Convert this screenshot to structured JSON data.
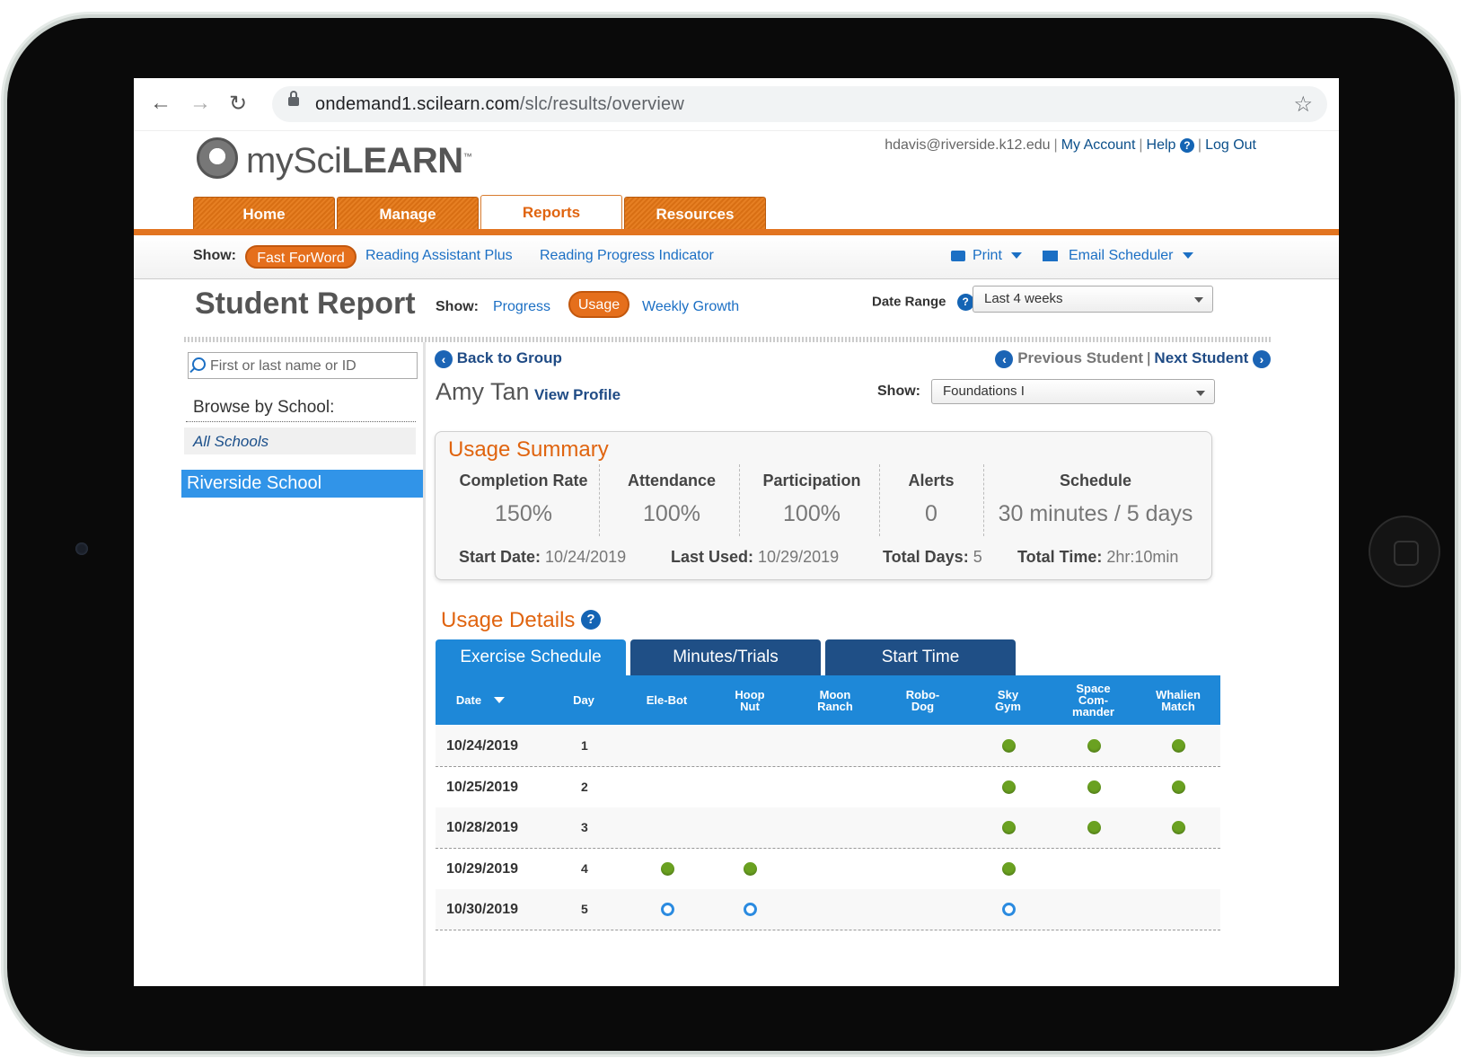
{
  "browser": {
    "url_host": "ondemand1.scilearn.com",
    "url_path": "/slc/results/overview"
  },
  "header": {
    "logo_prefix": "my",
    "logo_mid": "Sci",
    "logo_bold": "LEARN",
    "logo_tm": "™",
    "user_email": "hdavis@riverside.k12.edu",
    "my_account": "My Account",
    "help": "Help",
    "log_out": "Log Out"
  },
  "main_tabs": [
    {
      "label": "Home"
    },
    {
      "label": "Manage"
    },
    {
      "label": "Reports",
      "active": true
    },
    {
      "label": "Resources"
    }
  ],
  "subnav": {
    "show_label": "Show:",
    "product_active": "Fast ForWord",
    "product_2": "Reading Assistant Plus",
    "product_3": "Reading Progress Indicator",
    "print": "Print",
    "email_scheduler": "Email Scheduler"
  },
  "report": {
    "title": "Student Report",
    "show_label": "Show:",
    "view_progress": "Progress",
    "view_usage": "Usage",
    "view_weekly": "Weekly Growth",
    "date_range_label": "Date Range",
    "date_range_value": "Last 4 weeks"
  },
  "sidebar": {
    "search_placeholder": "First or last name or ID",
    "browse_label": "Browse by School:",
    "all_schools": "All Schools",
    "selected_school": "Riverside School"
  },
  "student": {
    "back": "Back to Group",
    "previous": "Previous Student",
    "next": "Next Student",
    "name": "Amy Tan",
    "view_profile": "View Profile",
    "show_label": "Show:",
    "product_value": "Foundations I"
  },
  "summary": {
    "title": "Usage Summary",
    "completion_rate_label": "Completion Rate",
    "completion_rate": "150%",
    "attendance_label": "Attendance",
    "attendance": "100%",
    "participation_label": "Participation",
    "participation": "100%",
    "alerts_label": "Alerts",
    "alerts": "0",
    "schedule_label": "Schedule",
    "schedule": "30 minutes / 5 days",
    "start_date_label": "Start Date:",
    "start_date": "10/24/2019",
    "last_used_label": "Last Used:",
    "last_used": "10/29/2019",
    "total_days_label": "Total Days:",
    "total_days": "5",
    "total_time_label": "Total Time:",
    "total_time": "2hr:10min"
  },
  "details": {
    "title": "Usage Details",
    "tabs": [
      "Exercise Schedule",
      "Minutes/Trials",
      "Start Time"
    ],
    "columns": [
      "Date",
      "Day",
      "Ele-Bot",
      "Hoop Nut",
      "Moon Ranch",
      "Robo-Dog",
      "Sky Gym",
      "Space Com-mander",
      "Whalien Match"
    ],
    "column_lines": [
      [
        "Date"
      ],
      [
        "Day"
      ],
      [
        "Ele-Bot"
      ],
      [
        "Hoop",
        "Nut"
      ],
      [
        "Moon",
        "Ranch"
      ],
      [
        "Robo-",
        "Dog"
      ],
      [
        "Sky",
        "Gym"
      ],
      [
        "Space",
        "Com-",
        "mander"
      ],
      [
        "Whalien",
        "Match"
      ]
    ],
    "rows": [
      {
        "date": "10/24/2019",
        "day": "1",
        "marks": [
          "",
          "",
          "",
          "",
          "done",
          "done",
          "done"
        ]
      },
      {
        "date": "10/25/2019",
        "day": "2",
        "marks": [
          "",
          "",
          "",
          "",
          "done",
          "done",
          "done"
        ]
      },
      {
        "date": "10/28/2019",
        "day": "3",
        "marks": [
          "",
          "",
          "",
          "",
          "done",
          "done",
          "done"
        ]
      },
      {
        "date": "10/29/2019",
        "day": "4",
        "marks": [
          "done",
          "done",
          "",
          "",
          "done",
          "",
          ""
        ]
      },
      {
        "date": "10/30/2019",
        "day": "5",
        "marks": [
          "scheduled",
          "scheduled",
          "",
          "",
          "scheduled",
          "",
          ""
        ]
      }
    ],
    "colors": {
      "done": "#6aa121",
      "scheduled": "#2b8be0"
    }
  }
}
